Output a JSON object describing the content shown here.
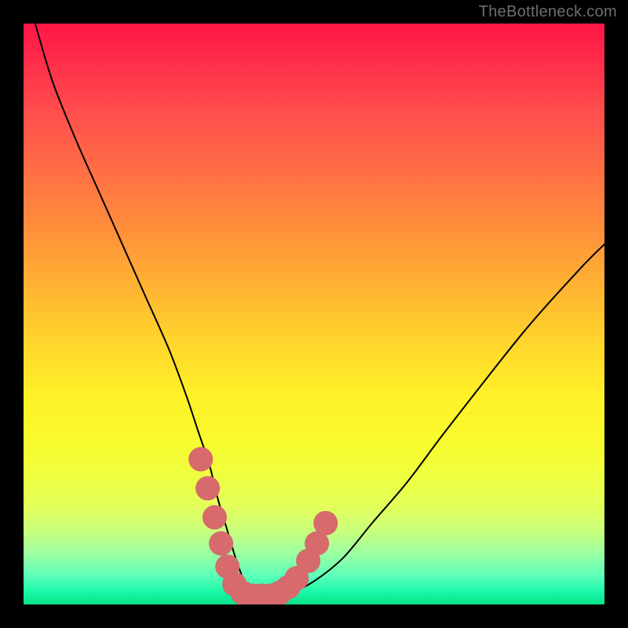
{
  "watermark": "TheBottleneck.com",
  "chart_data": {
    "type": "line",
    "title": "",
    "xlabel": "",
    "ylabel": "",
    "xlim": [
      0,
      100
    ],
    "ylim": [
      0,
      100
    ],
    "grid": false,
    "legend": false,
    "series": [
      {
        "name": "bottleneck-curve",
        "color": "#000000",
        "x": [
          2,
          5,
          9,
          13,
          17,
          21,
          25,
          28,
          30,
          32,
          33.5,
          35,
          36.5,
          38,
          39.5,
          41,
          43,
          46,
          50,
          55,
          60,
          66,
          72,
          79,
          87,
          96,
          100
        ],
        "y": [
          100,
          90,
          80,
          71,
          62,
          53,
          44,
          36,
          30,
          24,
          18,
          13,
          8,
          4,
          2,
          1.5,
          1.5,
          2,
          4,
          8,
          14,
          21,
          29,
          38,
          48,
          58,
          62
        ]
      }
    ],
    "markers": [
      {
        "x": 30.5,
        "y": 25,
        "r": 2.1,
        "color": "#d66a6d"
      },
      {
        "x": 31.7,
        "y": 20,
        "r": 2.1,
        "color": "#d66a6d"
      },
      {
        "x": 32.9,
        "y": 15,
        "r": 2.1,
        "color": "#d66a6d"
      },
      {
        "x": 34.0,
        "y": 10.5,
        "r": 2.1,
        "color": "#d66a6d"
      },
      {
        "x": 35.1,
        "y": 6.5,
        "r": 2.1,
        "color": "#d66a6d"
      },
      {
        "x": 36.3,
        "y": 3.5,
        "r": 2.1,
        "color": "#d66a6d"
      },
      {
        "x": 37.7,
        "y": 2.0,
        "r": 2.1,
        "color": "#d66a6d"
      },
      {
        "x": 39.3,
        "y": 1.5,
        "r": 2.1,
        "color": "#d66a6d"
      },
      {
        "x": 40.9,
        "y": 1.5,
        "r": 2.1,
        "color": "#d66a6d"
      },
      {
        "x": 42.5,
        "y": 1.5,
        "r": 2.1,
        "color": "#d66a6d"
      },
      {
        "x": 44.1,
        "y": 2.0,
        "r": 2.1,
        "color": "#d66a6d"
      },
      {
        "x": 45.6,
        "y": 3.0,
        "r": 2.1,
        "color": "#d66a6d"
      },
      {
        "x": 47.0,
        "y": 4.5,
        "r": 2.1,
        "color": "#d66a6d"
      },
      {
        "x": 49.0,
        "y": 7.5,
        "r": 2.1,
        "color": "#d66a6d"
      },
      {
        "x": 50.5,
        "y": 10.5,
        "r": 2.1,
        "color": "#d66a6d"
      },
      {
        "x": 52.0,
        "y": 14.0,
        "r": 2.1,
        "color": "#d66a6d"
      }
    ]
  }
}
